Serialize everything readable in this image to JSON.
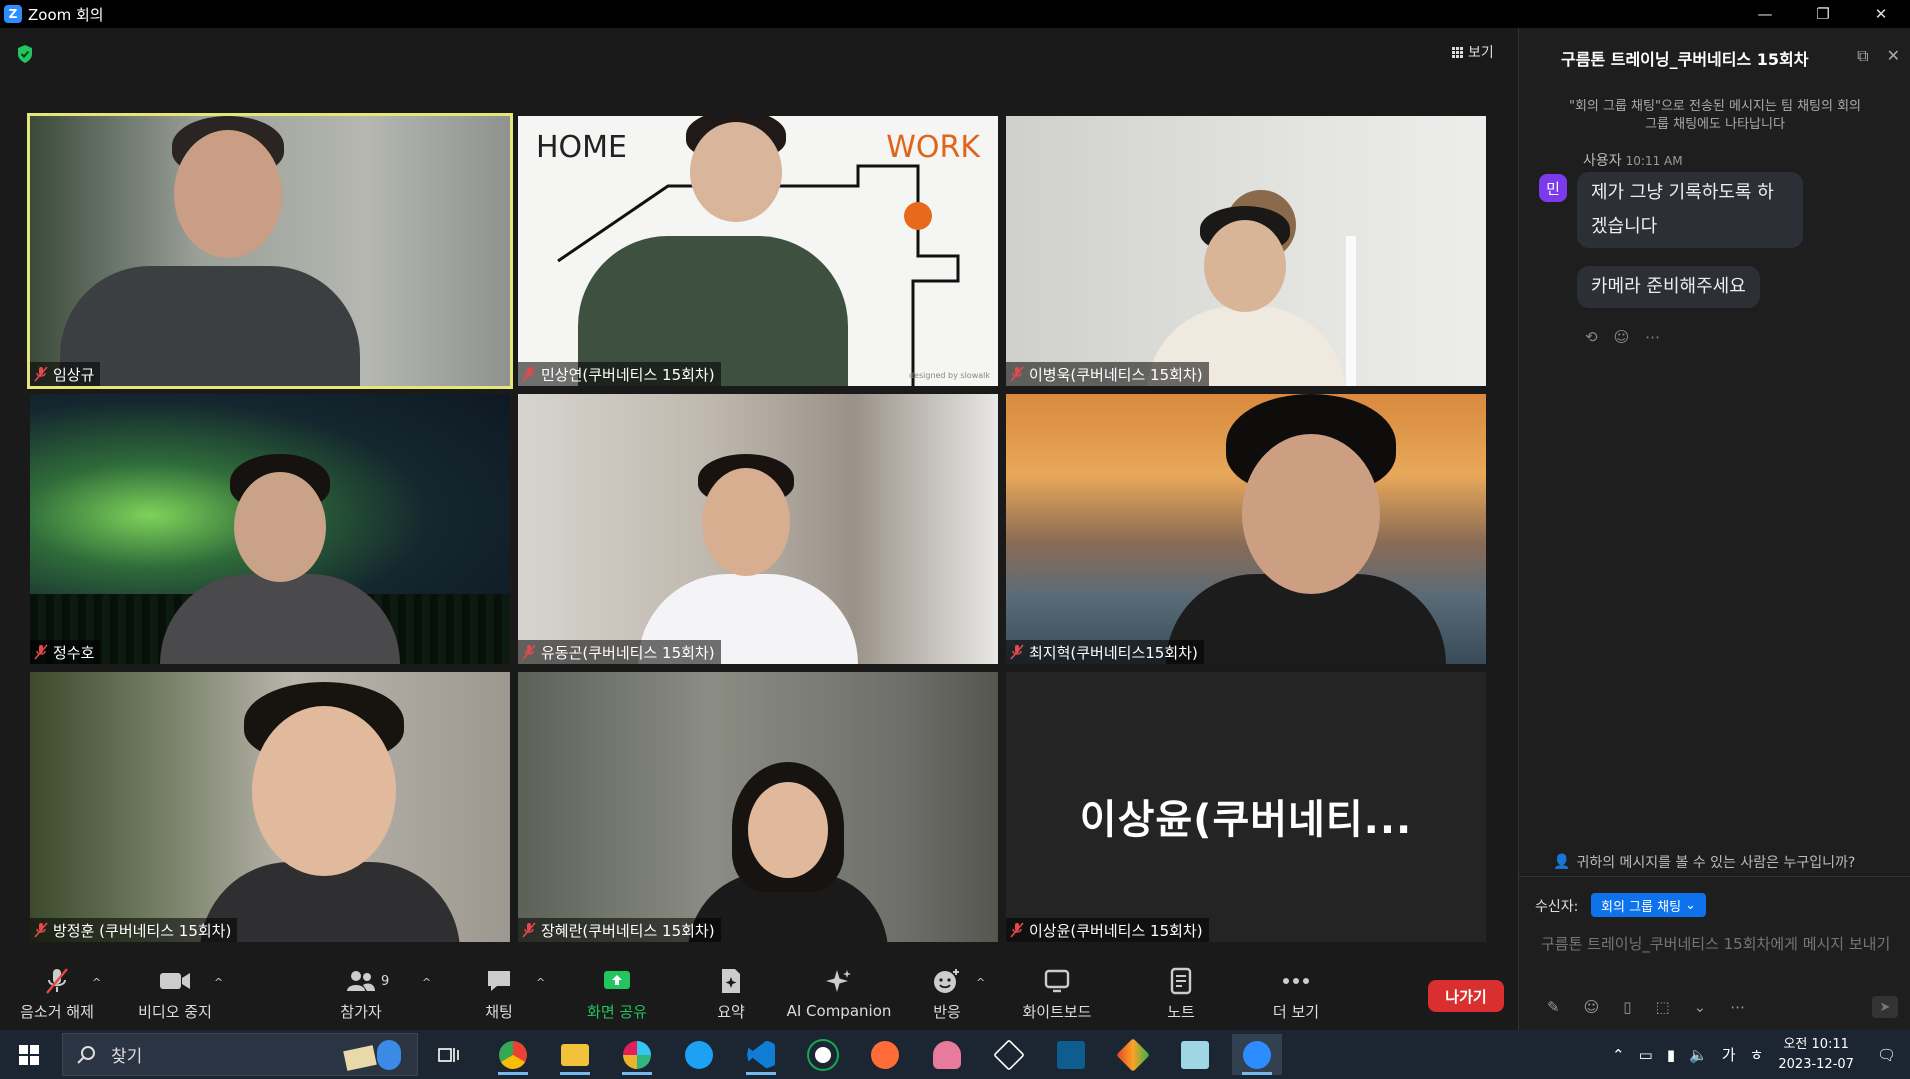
{
  "window": {
    "title": "Zoom 회의",
    "controls": [
      "—",
      "❐",
      "✕"
    ]
  },
  "meeting": {
    "view_label": "보기",
    "participants": [
      {
        "name": "임상규",
        "active": true
      },
      {
        "name": "민상연(쿠버네티스 15회차)",
        "bg_text_left": "HOME",
        "bg_text_right": "WORK",
        "watermark": "designed by slowalk"
      },
      {
        "name": "이병욱(쿠버네티스 15회차)"
      },
      {
        "name": "정수호"
      },
      {
        "name": "유동곤(쿠버네티스 15회차)"
      },
      {
        "name": "최지혁(쿠버네티스15회차)"
      },
      {
        "name": "방정훈 (쿠버네티스 15회차)"
      },
      {
        "name": "장혜란(쿠버네티스 15회차)"
      },
      {
        "name": "이상윤(쿠버네티스 15회차)",
        "display_name_large": "이상윤(쿠버네티..."
      }
    ]
  },
  "toolbar": {
    "unmute": "음소거 해제",
    "stop_video": "비디오 중지",
    "participants": "참가자",
    "participants_count": "9",
    "chat": "채팅",
    "share_screen": "화면 공유",
    "summary": "요약",
    "ai_companion": "AI Companion",
    "reactions": "반응",
    "whiteboard": "화이트보드",
    "notes": "노트",
    "more": "더 보기",
    "leave": "나가기"
  },
  "chat": {
    "title": "구름톤 트레이닝_쿠버네티스 15회차",
    "notice": "\"회의 그룹 채팅\"으로 전송된 메시지는 팀 채팅의 회의 그룹 채팅에도 나타납니다",
    "sender": "사용자",
    "time": "10:11 AM",
    "avatar": "민",
    "messages": [
      "제가 그냥 기록하도록 하겠습니다",
      "카메라 준비해주세요"
    ],
    "who_can_see": "귀하의 메시지를 볼 수 있는 사람은 누구입니까?",
    "to_label": "수신자:",
    "to_value": "회의 그룹 채팅",
    "input_placeholder": "구름톤 트레이닝_쿠버네티스 15회차에게 메시지 보내기"
  },
  "taskbar": {
    "search_label": "찾기",
    "ime": "가",
    "time": "오전 10:11",
    "date": "2023-12-07"
  }
}
